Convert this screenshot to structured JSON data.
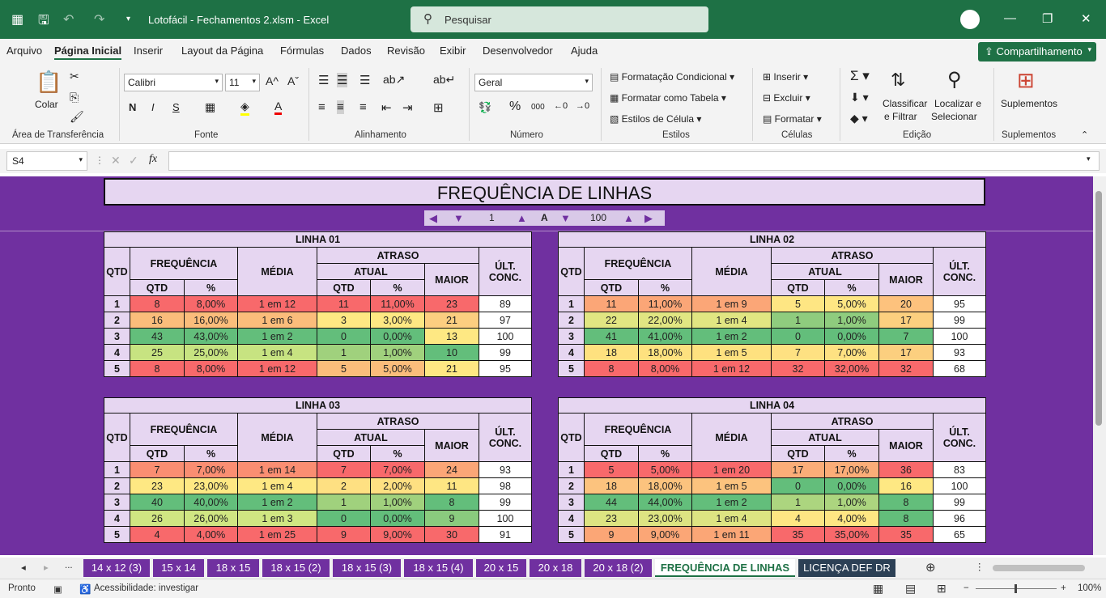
{
  "title_bar": {
    "doc_title": "Lotofácil - Fechamentos 2.xlsm  -  Excel",
    "search_placeholder": "Pesquisar"
  },
  "menu": [
    "Arquivo",
    "Página Inicial",
    "Inserir",
    "Layout da Página",
    "Fórmulas",
    "Dados",
    "Revisão",
    "Exibir",
    "Desenvolvedor",
    "Ajuda"
  ],
  "share_label": "Compartilhamento",
  "ribbon": {
    "paste_label": "Colar",
    "clipboard_group": "Área de Transferência",
    "font_name": "Calibri",
    "font_size": "11",
    "bold": "N",
    "italic": "I",
    "underline": "S",
    "font_group": "Fonte",
    "align_group": "Alinhamento",
    "number_format": "Geral",
    "number_group": "Número",
    "cond_format": "Formatação Condicional",
    "format_table": "Formatar como Tabela",
    "cell_styles": "Estilos de Célula",
    "styles_group": "Estilos",
    "insert": "Inserir",
    "delete": "Excluir",
    "format": "Formatar",
    "cells_group": "Células",
    "sort_filter_1": "Classificar",
    "sort_filter_2": "e Filtrar",
    "find_select_1": "Localizar e",
    "find_select_2": "Selecionar",
    "editing_group": "Edição",
    "addins": "Suplementos",
    "addins_group": "Suplementos"
  },
  "formula_bar": {
    "name_box": "S4",
    "fx": "fx",
    "formula": ""
  },
  "sheet": {
    "title": "FREQUÊNCIA DE LINHAS",
    "range_from": "1",
    "range_sep": "A",
    "range_to": "100",
    "headers": {
      "qtd": "QTD",
      "frequencia": "FREQUÊNCIA",
      "media": "MÉDIA",
      "atraso": "ATRASO",
      "atual": "ATUAL",
      "maior": "MAIOR",
      "ult1": "ÚLT.",
      "ult2": "CONC.",
      "pct": "%"
    },
    "tables": [
      {
        "name": "LINHA 01",
        "rows": [
          {
            "n": "1",
            "q": "8",
            "p": "8,00%",
            "m": "1 em 12",
            "aq": "11",
            "ap": "11,00%",
            "mx": "23",
            "u": "89"
          },
          {
            "n": "2",
            "q": "16",
            "p": "16,00%",
            "m": "1 em 6",
            "aq": "3",
            "ap": "3,00%",
            "mx": "21",
            "u": "97"
          },
          {
            "n": "3",
            "q": "43",
            "p": "43,00%",
            "m": "1 em 2",
            "aq": "0",
            "ap": "0,00%",
            "mx": "13",
            "u": "100"
          },
          {
            "n": "4",
            "q": "25",
            "p": "25,00%",
            "m": "1 em 4",
            "aq": "1",
            "ap": "1,00%",
            "mx": "10",
            "u": "99"
          },
          {
            "n": "5",
            "q": "8",
            "p": "8,00%",
            "m": "1 em 12",
            "aq": "5",
            "ap": "5,00%",
            "mx": "21",
            "u": "95"
          }
        ]
      },
      {
        "name": "LINHA 02",
        "rows": [
          {
            "n": "1",
            "q": "11",
            "p": "11,00%",
            "m": "1 em 9",
            "aq": "5",
            "ap": "5,00%",
            "mx": "20",
            "u": "95"
          },
          {
            "n": "2",
            "q": "22",
            "p": "22,00%",
            "m": "1 em 4",
            "aq": "1",
            "ap": "1,00%",
            "mx": "17",
            "u": "99"
          },
          {
            "n": "3",
            "q": "41",
            "p": "41,00%",
            "m": "1 em 2",
            "aq": "0",
            "ap": "0,00%",
            "mx": "7",
            "u": "100"
          },
          {
            "n": "4",
            "q": "18",
            "p": "18,00%",
            "m": "1 em 5",
            "aq": "7",
            "ap": "7,00%",
            "mx": "17",
            "u": "93"
          },
          {
            "n": "5",
            "q": "8",
            "p": "8,00%",
            "m": "1 em 12",
            "aq": "32",
            "ap": "32,00%",
            "mx": "32",
            "u": "68"
          }
        ]
      },
      {
        "name": "LINHA 03",
        "rows": [
          {
            "n": "1",
            "q": "7",
            "p": "7,00%",
            "m": "1 em 14",
            "aq": "7",
            "ap": "7,00%",
            "mx": "24",
            "u": "93"
          },
          {
            "n": "2",
            "q": "23",
            "p": "23,00%",
            "m": "1 em 4",
            "aq": "2",
            "ap": "2,00%",
            "mx": "11",
            "u": "98"
          },
          {
            "n": "3",
            "q": "40",
            "p": "40,00%",
            "m": "1 em 2",
            "aq": "1",
            "ap": "1,00%",
            "mx": "8",
            "u": "99"
          },
          {
            "n": "4",
            "q": "26",
            "p": "26,00%",
            "m": "1 em 3",
            "aq": "0",
            "ap": "0,00%",
            "mx": "9",
            "u": "100"
          },
          {
            "n": "5",
            "q": "4",
            "p": "4,00%",
            "m": "1 em 25",
            "aq": "9",
            "ap": "9,00%",
            "mx": "30",
            "u": "91"
          }
        ]
      },
      {
        "name": "LINHA 04",
        "rows": [
          {
            "n": "1",
            "q": "5",
            "p": "5,00%",
            "m": "1 em 20",
            "aq": "17",
            "ap": "17,00%",
            "mx": "36",
            "u": "83"
          },
          {
            "n": "2",
            "q": "18",
            "p": "18,00%",
            "m": "1 em 5",
            "aq": "0",
            "ap": "0,00%",
            "mx": "16",
            "u": "100"
          },
          {
            "n": "3",
            "q": "44",
            "p": "44,00%",
            "m": "1 em 2",
            "aq": "1",
            "ap": "1,00%",
            "mx": "8",
            "u": "99"
          },
          {
            "n": "4",
            "q": "23",
            "p": "23,00%",
            "m": "1 em 4",
            "aq": "4",
            "ap": "4,00%",
            "mx": "8",
            "u": "96"
          },
          {
            "n": "5",
            "q": "9",
            "p": "9,00%",
            "m": "1 em 11",
            "aq": "35",
            "ap": "35,00%",
            "mx": "35",
            "u": "65"
          }
        ]
      }
    ],
    "colors": {
      "t0": [
        "#f8696b",
        "#fbbd7b",
        "#63be7b",
        "#c7e381",
        "#f8696b"
      ],
      "t0a": [
        "#f8696b",
        "#fee883",
        "#63be7b",
        "#a0d17d",
        "#fbbd7b"
      ],
      "t0m": [
        "#f8696b",
        "#fcce80",
        "#fee883",
        "#63be7b",
        "#fee883"
      ],
      "t1": [
        "#fba677",
        "#e1e682",
        "#63be7b",
        "#fee17f",
        "#f8696b"
      ],
      "t1a": [
        "#fee683",
        "#8fcc7e",
        "#63be7b",
        "#fee182",
        "#f8696b"
      ],
      "t1m": [
        "#fdc27d",
        "#fccf7f",
        "#63be7b",
        "#fccf7f",
        "#f8696b"
      ],
      "t2": [
        "#fa8e72",
        "#fee883",
        "#63be7b",
        "#d0e682",
        "#f8696b"
      ],
      "t2a": [
        "#f8696b",
        "#fee082",
        "#a0d17d",
        "#63be7b",
        "#f8696b"
      ],
      "t2m": [
        "#fba677",
        "#fee683",
        "#63be7b",
        "#8acb7e",
        "#f8696b"
      ],
      "t3": [
        "#f8696b",
        "#fcc37e",
        "#63be7b",
        "#dde482",
        "#fba676"
      ],
      "t3a": [
        "#fbad78",
        "#63be7b",
        "#acd57f",
        "#fee683",
        "#f8696b"
      ],
      "t3m": [
        "#f8696b",
        "#fee883",
        "#63be7b",
        "#63be7b",
        "#f8696b"
      ]
    }
  },
  "tabs": [
    "...",
    "14 x 12 (3)",
    "15 x 14",
    "18 x 15",
    "18 x 15 (2)",
    "18 x 15 (3)",
    "18 x 15 (4)",
    "20 x 15",
    "20 x 18",
    "20 x 18 (2)",
    "FREQUÊNCIA DE LINHAS",
    "LICENÇA DEF DR"
  ],
  "status": {
    "ready": "Pronto",
    "accessibility": "Acessibilidade: investigar",
    "zoom": "100%"
  }
}
